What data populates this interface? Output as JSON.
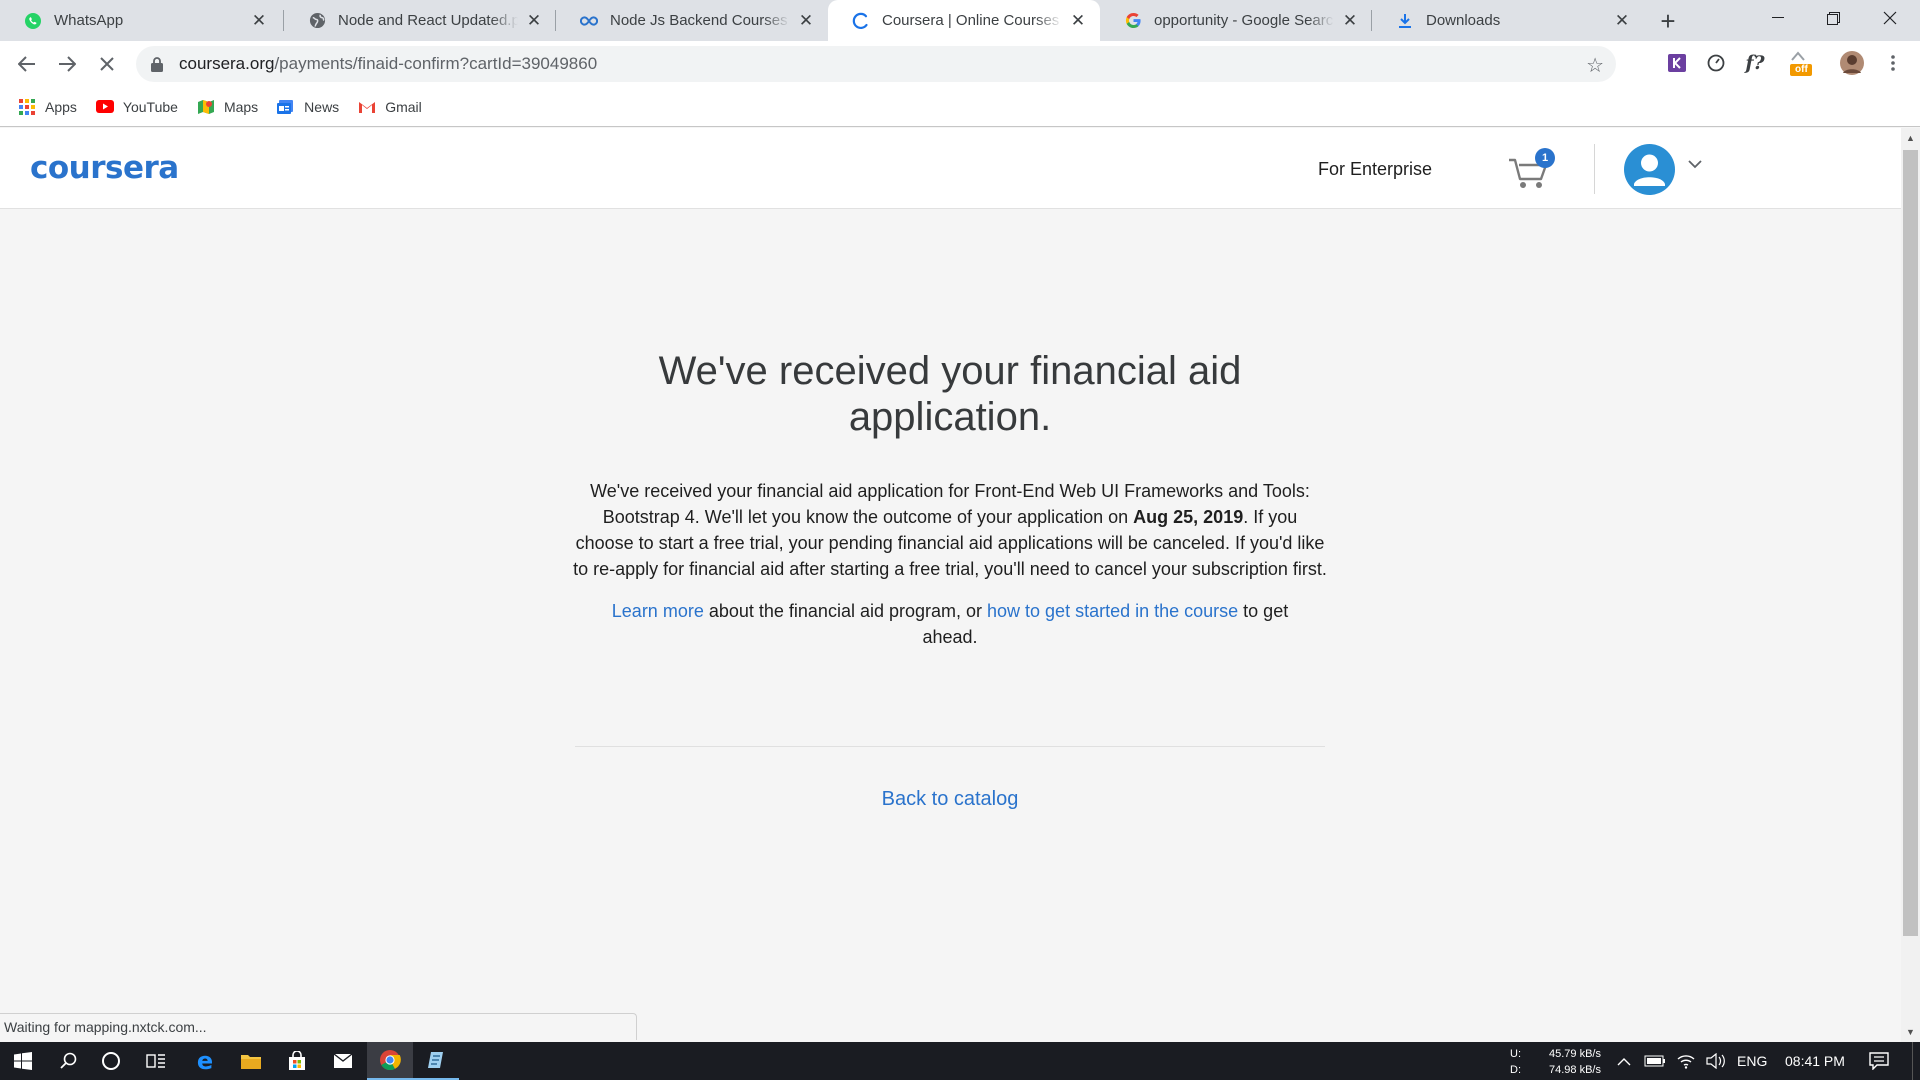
{
  "browser": {
    "tabs": [
      {
        "title": "WhatsApp",
        "icon": "whatsapp-icon",
        "active": false
      },
      {
        "title": "Node and React Updated.pdf",
        "icon": "globe-icon",
        "active": false
      },
      {
        "title": "Node Js Backend Courses | C",
        "icon": "coursera-infinity-icon",
        "active": false
      },
      {
        "title": "Coursera | Online Courses Fr",
        "icon": "loading-spinner-icon",
        "active": true
      },
      {
        "title": "opportunity - Google Search",
        "icon": "google-icon",
        "active": false
      },
      {
        "title": "Downloads",
        "icon": "download-icon",
        "active": false
      }
    ],
    "url_host": "coursera.org",
    "url_path": "/payments/finaid-confirm?cartId=39049860",
    "bookmarks": [
      {
        "label": "Apps",
        "icon": "apps-grid-icon"
      },
      {
        "label": "YouTube",
        "icon": "youtube-icon"
      },
      {
        "label": "Maps",
        "icon": "maps-icon"
      },
      {
        "label": "News",
        "icon": "news-icon"
      },
      {
        "label": "Gmail",
        "icon": "gmail-icon"
      }
    ],
    "extension_badge": "off",
    "status_text": "Waiting for mapping.nxtck.com..."
  },
  "site": {
    "logo": "coursera",
    "nav_enterprise": "For Enterprise",
    "cart_count": "1",
    "accent_color": "#2a73cc"
  },
  "main": {
    "headline": "We've received your financial aid application.",
    "para1_a": "We've received your financial aid application for Front-End Web UI Frameworks and Tools: Bootstrap 4. We'll let you know the outcome of your application on ",
    "para1_date": "Aug 25, 2019",
    "para1_b": ". If you choose to start a free trial, your pending financial aid applications will be canceled. If you'd like to re-apply for financial aid after starting a free trial, you'll need to cancel your subscription first.",
    "para2_link1": "Learn more",
    "para2_mid": " about the financial aid program, or ",
    "para2_link2": "how to get started in the course",
    "para2_end": " to get ahead.",
    "back_link": "Back to catalog"
  },
  "taskbar": {
    "net_up_label": "U:",
    "net_down_label": "D:",
    "net_up": "45.79 kB/s",
    "net_down": "74.98 kB/s",
    "lang": "ENG",
    "time": "08:41 PM"
  }
}
